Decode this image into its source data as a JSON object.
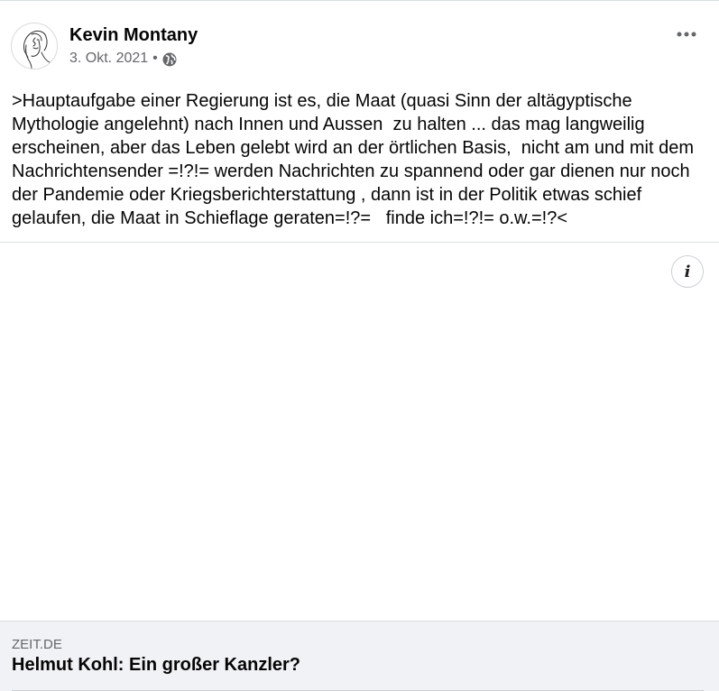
{
  "post": {
    "author": "Kevin Montany",
    "date": "3. Okt. 2021",
    "separator": "•",
    "privacy_icon": "globe-icon",
    "more_icon": "more-options-icon",
    "text": ">Hauptaufgabe einer Regierung ist es, die Maat (quasi Sinn der altägyptische Mythologie angelehnt) nach Innen und Aussen  zu halten ... das mag langweilig erscheinen, aber das Leben gelebt wird an der örtlichen Basis,  nicht am und mit dem Nachrichtensender =!?!= werden Nachrichten zu spannend oder gar dienen nur noch der Pandemie oder Kriegsberichterstattung , dann ist in der Politik etwas schief gelaufen, die Maat in Schieflage geraten=!?=   finde ich=!?!= o.w.=!?<"
  },
  "media": {
    "info_label": "i",
    "info_icon": "info-icon"
  },
  "link_preview": {
    "domain": "ZEIT.DE",
    "title": "Helmut Kohl: Ein großer Kanzler?"
  },
  "colors": {
    "secondary_text": "#65676b",
    "card_background": "#f0f2f5",
    "divider": "#dadde1"
  }
}
